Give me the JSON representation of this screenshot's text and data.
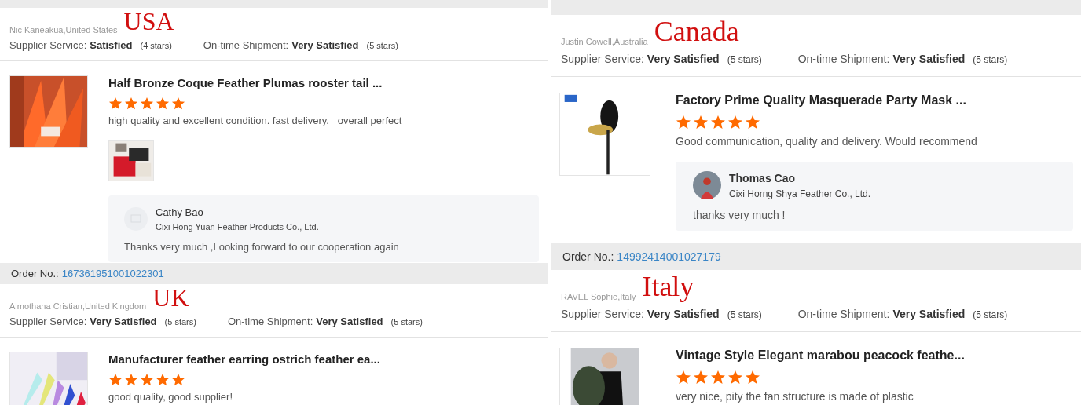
{
  "columns": [
    {
      "panels": [
        {
          "tag": "USA",
          "reviewer": "Nic Kaneakua,United States",
          "ratings": [
            {
              "label": "Supplier Service:",
              "value": "Satisfied",
              "stars_text": "(4 stars)"
            },
            {
              "label": "On-time Shipment:",
              "value": "Very Satisfied",
              "stars_text": "(5 stars)"
            }
          ],
          "product": {
            "title": "Half Bronze Coque Feather Plumas rooster tail ...",
            "stars": 5,
            "comment": "high quality and excellent condition. fast delivery.   overall perfect",
            "reply": {
              "avatar": {
                "kind": "placeholder"
              },
              "name": "Cathy Bao",
              "company": "Cixi Hong Yuan Feather Products Co., Ltd.",
              "message": "Thanks very much ,Looking forward to our cooperation again"
            }
          }
        },
        {
          "order": {
            "label": "Order No.:",
            "number": "167361951001022301"
          },
          "tag": "UK",
          "reviewer": "Almothana Cristian,United Kingdom",
          "ratings": [
            {
              "label": "Supplier Service:",
              "value": "Very Satisfied",
              "stars_text": "(5 stars)"
            },
            {
              "label": "On-time Shipment:",
              "value": "Very Satisfied",
              "stars_text": "(5 stars)"
            }
          ],
          "product": {
            "title": "Manufacturer feather earring ostrich feather ea...",
            "stars": 5,
            "comment": "good quality, good supplier!"
          }
        }
      ]
    },
    {
      "panels": [
        {
          "tag": "Canada",
          "reviewer": "Justin Cowell,Australia",
          "ratings": [
            {
              "label": "Supplier Service:",
              "value": "Very Satisfied",
              "stars_text": "(5 stars)"
            },
            {
              "label": "On-time Shipment:",
              "value": "Very Satisfied",
              "stars_text": "(5 stars)"
            }
          ],
          "product": {
            "title": "Factory Prime Quality Masquerade Party Mask ...",
            "stars": 5,
            "comment": "Good communication, quality and delivery. Would recommend",
            "reply": {
              "name": "Thomas Cao",
              "company": "Cixi Horng Shya Feather Co., Ltd.",
              "message": "thanks very much !"
            }
          }
        },
        {
          "order": {
            "label": "Order No.:",
            "number": "14992414001027179"
          },
          "tag": "Italy",
          "reviewer": "RAVEL Sophie,Italy",
          "ratings": [
            {
              "label": "Supplier Service:",
              "value": "Very Satisfied",
              "stars_text": "(5 stars)"
            },
            {
              "label": "On-time Shipment:",
              "value": "Very Satisfied",
              "stars_text": "(5 stars)"
            }
          ],
          "product": {
            "title": "Vintage Style Elegant marabou peacock feathe...",
            "stars": 5,
            "comment": "very nice, pity the fan structure is made of plastic"
          }
        }
      ]
    }
  ]
}
